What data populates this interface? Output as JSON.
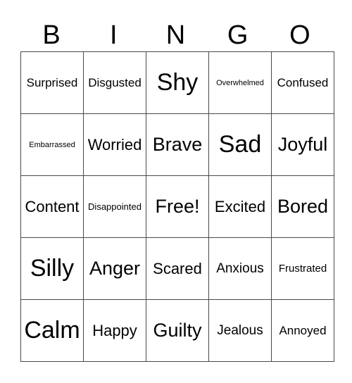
{
  "header": {
    "letters": [
      "B",
      "I",
      "N",
      "G",
      "O"
    ]
  },
  "grid": {
    "rows": [
      [
        "Surprised",
        "Disgusted",
        "Shy",
        "Overwhelmed",
        "Confused"
      ],
      [
        "Embarrassed",
        "Worried",
        "Brave",
        "Sad",
        "Joyful"
      ],
      [
        "Content",
        "Disappointed",
        "Free!",
        "Excited",
        "Bored"
      ],
      [
        "Silly",
        "Anger",
        "Scared",
        "Anxious",
        "Frustrated"
      ],
      [
        "Calm",
        "Happy",
        "Guilty",
        "Jealous",
        "Annoyed"
      ]
    ]
  }
}
